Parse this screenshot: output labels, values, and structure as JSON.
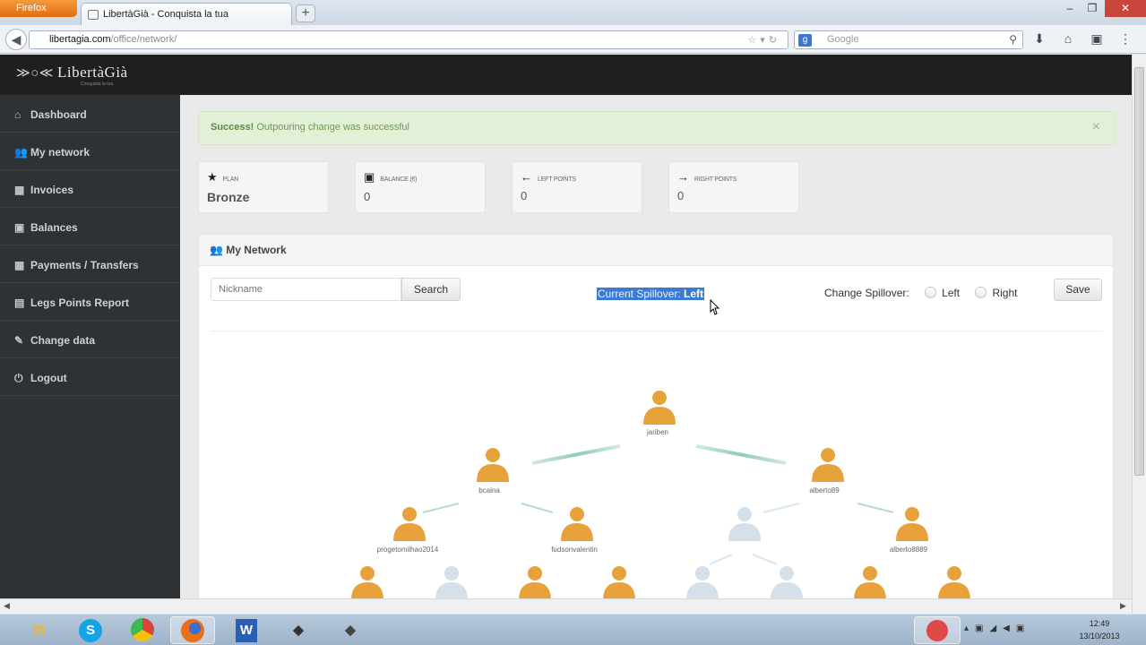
{
  "browser": {
    "menu_button": "Firefox",
    "tab_title": "LibertàGià - Conquista la tua",
    "new_tab": "+",
    "url_host": "libertagia.com",
    "url_path": "/office/network/",
    "search_placeholder": "Google",
    "window_controls": {
      "minimize": "–",
      "restore": "❐",
      "close": "✕"
    }
  },
  "app": {
    "logo_text": "LibertàGià",
    "logo_tagline": "Conquista la tua"
  },
  "sidebar": {
    "items": [
      {
        "label": "Dashboard",
        "icon": "home-icon",
        "glyph": "⌂"
      },
      {
        "label": "My network",
        "icon": "users-icon",
        "glyph": "👥"
      },
      {
        "label": "Invoices",
        "icon": "grid-icon",
        "glyph": "▦"
      },
      {
        "label": "Balances",
        "icon": "money-icon",
        "glyph": "▣"
      },
      {
        "label": "Payments / Transfers",
        "icon": "table-icon",
        "glyph": "▦"
      },
      {
        "label": "Legs Points Report",
        "icon": "chart-icon",
        "glyph": "▤"
      },
      {
        "label": "Change data",
        "icon": "edit-icon",
        "glyph": "✎"
      },
      {
        "label": "Logout",
        "icon": "power-icon",
        "glyph": "⏻"
      }
    ]
  },
  "alert": {
    "strong": "Success!",
    "message": " Outpouring change was successful",
    "close": "×"
  },
  "stats": [
    {
      "label": "PLAN",
      "value": "Bronze",
      "icon": "star-icon",
      "glyph": "★"
    },
    {
      "label": "BALANCE (€)",
      "value": "0",
      "icon": "money-icon",
      "glyph": "▣"
    },
    {
      "label": "LEFT POINTS",
      "value": "0",
      "icon": "arrow-left-icon",
      "glyph": "←"
    },
    {
      "label": "RIGHT POINTS",
      "value": "0",
      "icon": "arrow-right-icon",
      "glyph": "→"
    }
  ],
  "network": {
    "title": "My Network",
    "search_placeholder": "Nickname",
    "search_button": "Search",
    "spillover_label": "Current Spillover: ",
    "spillover_value": "Left",
    "change_label": "Change Spillover:",
    "option_left": "Left",
    "option_right": "Right",
    "save_button": "Save",
    "tree": [
      {
        "name": "jariben",
        "status": "active"
      },
      {
        "name": "bcaina",
        "status": "active"
      },
      {
        "name": "alberto89",
        "status": "active"
      },
      {
        "name": "progetomilhao2014",
        "status": "active"
      },
      {
        "name": "fudsonvalentin",
        "status": "active"
      },
      {
        "name": "",
        "status": "empty"
      },
      {
        "name": "alberto8889",
        "status": "active"
      }
    ]
  },
  "colors": {
    "header": "#1f1f1f",
    "sidebar": "#2f3235",
    "alert_bg": "#e1f0d6",
    "alert_text": "#6e9a52",
    "selection": "#3a7bd5",
    "node_active": "#e8a23c",
    "node_empty": "#d6e0ea"
  },
  "taskbar": {
    "apps": [
      "file-explorer-icon",
      "skype-icon",
      "chrome-icon",
      "firefox-icon",
      "word-icon",
      "app-icon",
      "app-icon"
    ],
    "word_letter": "W",
    "time": "12:49",
    "date": "13/10/2013"
  }
}
